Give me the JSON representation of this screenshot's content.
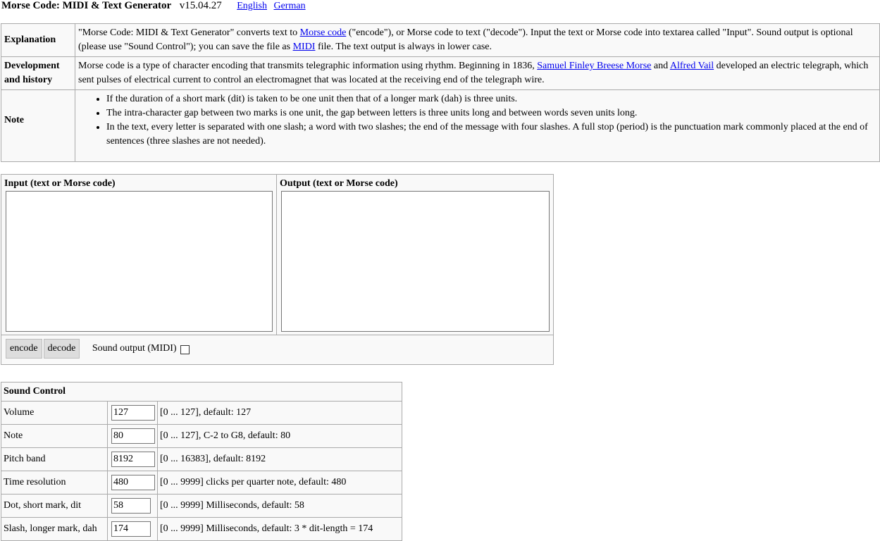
{
  "header": {
    "title": "Morse Code: MIDI & Text Generator",
    "version": "v15.04.27",
    "languages": [
      "English",
      "German"
    ]
  },
  "info": {
    "explanation": {
      "heading": "Explanation",
      "text_1": "\"Morse Code: MIDI & Text Generator\" converts text to ",
      "link_1": "Morse code",
      "text_2": " (\"encode\"), or Morse code to text (\"decode\"). Input the text or Morse code into textarea called \"Input\". Sound output is optional (please use \"Sound Control\"); you can save the file as ",
      "link_2": "MIDI",
      "text_3": " file. The text output is always in lower case."
    },
    "history": {
      "heading": "Development and history",
      "text_1": "Morse code is a type of character encoding that transmits telegraphic information using rhythm. Beginning in 1836, ",
      "link_1": "Samuel Finley Breese Morse",
      "text_2": " and ",
      "link_2": "Alfred Vail",
      "text_3": " developed an electric telegraph, which sent pulses of electrical current to control an electromagnet that was located at the receiving end of the telegraph wire."
    },
    "note": {
      "heading": "Note",
      "items": [
        "If the duration of a short mark (dit) is taken to be one unit then that of a longer mark (dah) is three units.",
        "The intra-character gap between two marks is one unit, the gap between letters is three units long and between words seven units long.",
        "In the text, every letter is separated with one slash; a word with two slashes; the end of the message with four slashes. A full stop (period) is the punctuation mark commonly placed at the end of sentences (three slashes are not needed)."
      ]
    }
  },
  "io": {
    "input_label": "Input (text or Morse code)",
    "input_value": "",
    "output_label": "Output (text or Morse code)",
    "output_value": "",
    "encode_label": "encode",
    "decode_label": "decode",
    "sound_output_label": "Sound output (MIDI)",
    "sound_output_checked": false
  },
  "sound_control": {
    "heading": "Sound Control",
    "rows": [
      {
        "label": "Volume",
        "value": "127",
        "hint": "[0 ... 127], default: 127"
      },
      {
        "label": "Note",
        "value": "80",
        "hint": "[0 ... 127], C-2 to G8, default: 80"
      },
      {
        "label": "Pitch band",
        "value": "8192",
        "hint": "[0 ... 16383], default: 8192"
      },
      {
        "label": "Time resolution",
        "value": "480",
        "hint": "[0 ... 9999] clicks per quarter note, default: 480"
      },
      {
        "label": "Dot, short mark, dit",
        "value": "58",
        "hint": "[0 ... 9999] Milliseconds, default: 58"
      },
      {
        "label": "Slash, longer mark, dah",
        "value": "174",
        "hint": "[0 ... 9999] Milliseconds, default: 3 * dit-length = 174"
      }
    ]
  }
}
